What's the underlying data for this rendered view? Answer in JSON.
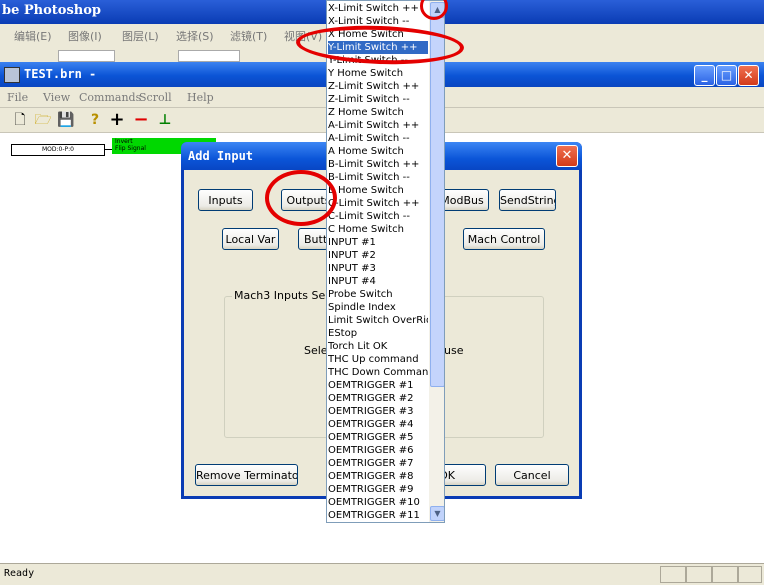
{
  "background_app": {
    "title": "be Photoshop",
    "menu": [
      "编辑(E)",
      "图像(I)",
      "图层(L)",
      "选择(S)",
      "滤镜(T)",
      "视图(V)"
    ]
  },
  "window": {
    "title": "TEST.brn -",
    "menu": [
      "File",
      "View",
      "Commands",
      "Scroll",
      "Help"
    ]
  },
  "ladder": {
    "box_label": "MOD:0-P:0",
    "green_line1": "Invert",
    "green_line2": "Flip Signal"
  },
  "status": {
    "text": "Ready"
  },
  "dialog": {
    "title": "Add Input",
    "buttons": {
      "inputs": "Inputs",
      "outputs": "Outputs",
      "modbus": "ModBus",
      "sendstring": "SendString",
      "localvar": "Local Var",
      "button": "Butto",
      "mach_control": "Mach Control",
      "remove_terminator": "Remove Terminator",
      "ok": "OK",
      "cancel": "Cancel"
    },
    "group_label": "Mach3 Inputs Selec",
    "group_text_left": "Sele",
    "group_text_right": "use"
  },
  "dropdown": {
    "selected": "Y-Limit Switch ++",
    "items": [
      "X-Limit Switch ++",
      "X-Limit Switch --",
      "X Home Switch",
      "Y-Limit Switch ++",
      "Y-Limit Switch --",
      "Y Home Switch",
      "Z-Limit Switch ++",
      "Z-Limit Switch --",
      "Z Home Switch",
      "A-Limit Switch ++",
      "A-Limit Switch --",
      "A Home Switch",
      "B-Limit Switch ++",
      "B-Limit Switch --",
      "B Home Switch",
      "C-Limit Switch ++",
      "C-Limit Switch --",
      "C Home Switch",
      "INPUT #1",
      "INPUT #2",
      "INPUT #3",
      "INPUT #4",
      "Probe Switch",
      "Spindle Index",
      "Limit Switch OverRide",
      "EStop",
      "Torch Lit OK",
      "THC Up command",
      "THC Down Command",
      "OEMTRIGGER #1",
      "OEMTRIGGER #2",
      "OEMTRIGGER #3",
      "OEMTRIGGER #4",
      "OEMTRIGGER #5",
      "OEMTRIGGER #6",
      "OEMTRIGGER #7",
      "OEMTRIGGER #8",
      "OEMTRIGGER #9",
      "OEMTRIGGER #10",
      "OEMTRIGGER #11"
    ]
  },
  "icons": [
    "new-file-icon",
    "open-folder-icon",
    "save-icon",
    "help-icon",
    "add-icon",
    "remove-icon",
    "ladder-rung-icon",
    "scroll-up-icon",
    "scroll-down-icon"
  ],
  "colors": {
    "selection": "#316ac5",
    "annotation": "#e40000",
    "ladder_green": "#00d800"
  }
}
